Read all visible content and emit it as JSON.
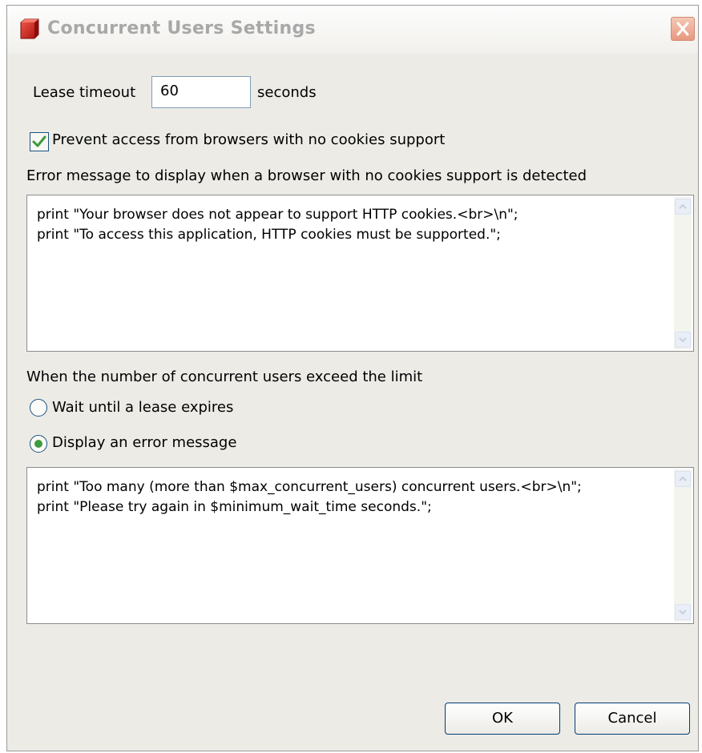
{
  "dialog": {
    "title": "Concurrent Users Settings",
    "lease_timeout_label": "Lease timeout",
    "lease_timeout_value": "60",
    "seconds_label": "seconds",
    "prevent_cookies_label": "Prevent access from browsers with no cookies support",
    "prevent_cookies_checked": true,
    "cookie_error_label": "Error message to display when a browser with no cookies support is detected",
    "cookie_error_text": "print \"Your browser does not appear to support HTTP cookies.<br>\\n\";\nprint \"To access this application, HTTP cookies must be supported.\";",
    "exceed_label": "When the number of concurrent users exceed the limit",
    "radio_wait_label": "Wait until a lease expires",
    "radio_display_label": "Display an error message",
    "selected_option": "Display an error message",
    "limit_error_text": "print \"Too many (more than $max_concurrent_users) concurrent users.<br>\\n\";\nprint \"Please try again in $minimum_wait_time seconds.\";",
    "ok_label": "OK",
    "cancel_label": "Cancel"
  },
  "icons": {
    "app": "app-icon",
    "close": "close-icon",
    "check": "checkmark-icon",
    "scroll_up": "scroll-up-arrow-icon",
    "scroll_down": "scroll-down-arrow-icon"
  },
  "colors": {
    "dialog_bg": "#ecebe6",
    "title_text": "#a8a8a8",
    "close_button": "#e89880",
    "checkmark": "#3c9a3c",
    "radio_selected": "#3f9b3f",
    "button_border": "#003c74"
  }
}
